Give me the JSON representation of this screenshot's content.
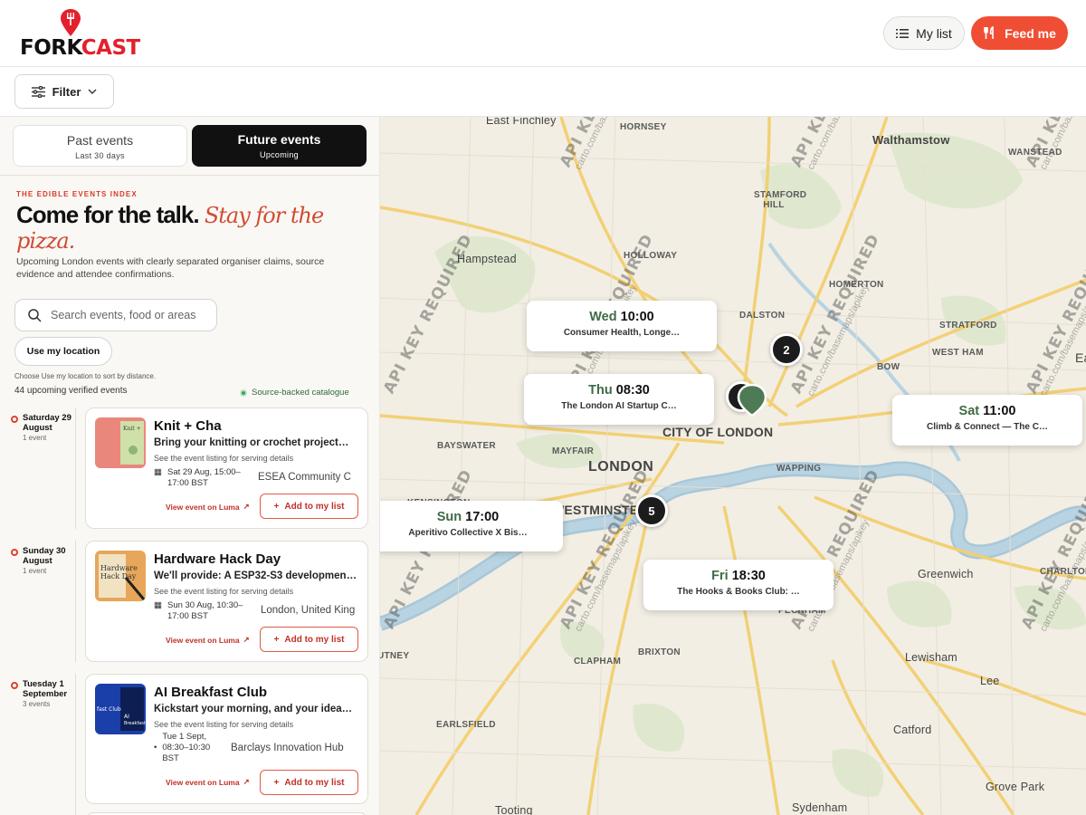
{
  "header": {
    "logo_text_a": "FORK",
    "logo_text_b": "CAST",
    "mylist_label": "My list",
    "feed_label": "Feed me"
  },
  "filter": {
    "label": "Filter"
  },
  "tabs": [
    {
      "label": "Past events",
      "sub": "Last 30 days"
    },
    {
      "label": "Future events",
      "sub": "Upcoming"
    }
  ],
  "intro": {
    "eyebrow": "THE EDIBLE EVENTS INDEX",
    "headline_a": "Come for the talk.",
    "headline_b": "Stay for the pizza.",
    "subtext": "Upcoming London events with clearly separated organiser claims, source evidence and attendee confirmations."
  },
  "search": {
    "placeholder": "Search events, food or areas"
  },
  "location_button": "Use my location",
  "location_hint": "Choose Use my location to sort by distance.",
  "event_count": "44 upcoming verified events",
  "catalogue_label": "Source-backed catalogue",
  "days": [
    {
      "label": "Saturday 29 August",
      "count": "1 event",
      "event": {
        "title": "Knit + Cha",
        "desc": "Bring your knitting or crochet project…",
        "serving": "See the event listing for serving details",
        "when": "Sat 29 Aug, 15:00–17:00 BST",
        "where": "ESEA Community C",
        "link": "View event on Luma",
        "add": "Add to my list"
      }
    },
    {
      "label": "Sunday 30 August",
      "count": "1 event",
      "event": {
        "title": "Hardware Hack Day",
        "desc": "We'll provide: A ESP32-S3 developmen…",
        "serving": "See the event listing for serving details",
        "when": "Sun 30 Aug, 10:30–17:00 BST",
        "where": "London, United King",
        "link": "View event on Luma",
        "add": "Add to my list"
      }
    },
    {
      "label": "Tuesday 1 September",
      "count": "3 events",
      "event": {
        "title": "AI Breakfast Club",
        "desc": "Kickstart your morning, and your idea…",
        "serving": "See the event listing for serving details",
        "when": "Tue 1 Sept, 08:30–10:30 BST",
        "where": "Barclays Innovation Hub",
        "link": "View event on Luma",
        "add": "Add to my list"
      }
    }
  ],
  "map": {
    "places": [
      "East Finchley",
      "HORNSEY",
      "Walthamstow",
      "WANSTEAD",
      "STAMFORD HILL",
      "Hampstead",
      "HOLLOWAY",
      "HOMERTON",
      "DALSTON",
      "STRATFORD",
      "WEST HAM",
      "BOW",
      "CITY OF LONDON",
      "BAYSWATER",
      "MAYFAIR",
      "LONDON",
      "WAPPING",
      "WESTMINSTER",
      "Greenwich",
      "CHARLTON",
      "CLAPHAM",
      "BRIXTON",
      "PECKHAM",
      "Lewisham",
      "Lee",
      "EARLSFIELD",
      "Catford",
      "Grove Park",
      "Tooting",
      "Sydenham",
      "PUTNEY",
      "KENSINGTON",
      "Ea"
    ],
    "watermark": "API KEY REQUIRED",
    "watermark_sub": "carto.com/basemaps/apikey",
    "bubbles": [
      {
        "day": "Wed",
        "time": "10:00",
        "name": "Consumer Health, Longe…"
      },
      {
        "day": "Thu",
        "time": "08:30",
        "name": "The London AI Startup C…"
      },
      {
        "day": "Sat",
        "time": "11:00",
        "name": "Climb & Connect — The C…"
      },
      {
        "day": "Sun",
        "time": "17:00",
        "name": "Aperitivo Collective X Bis…"
      },
      {
        "day": "Fri",
        "time": "18:30",
        "name": "The Hooks & Books Club: …"
      }
    ],
    "clusters": [
      "2",
      "5"
    ]
  },
  "colors": {
    "accent": "#f04e34",
    "brand_red": "#e3202b",
    "green": "#3f6b46"
  }
}
